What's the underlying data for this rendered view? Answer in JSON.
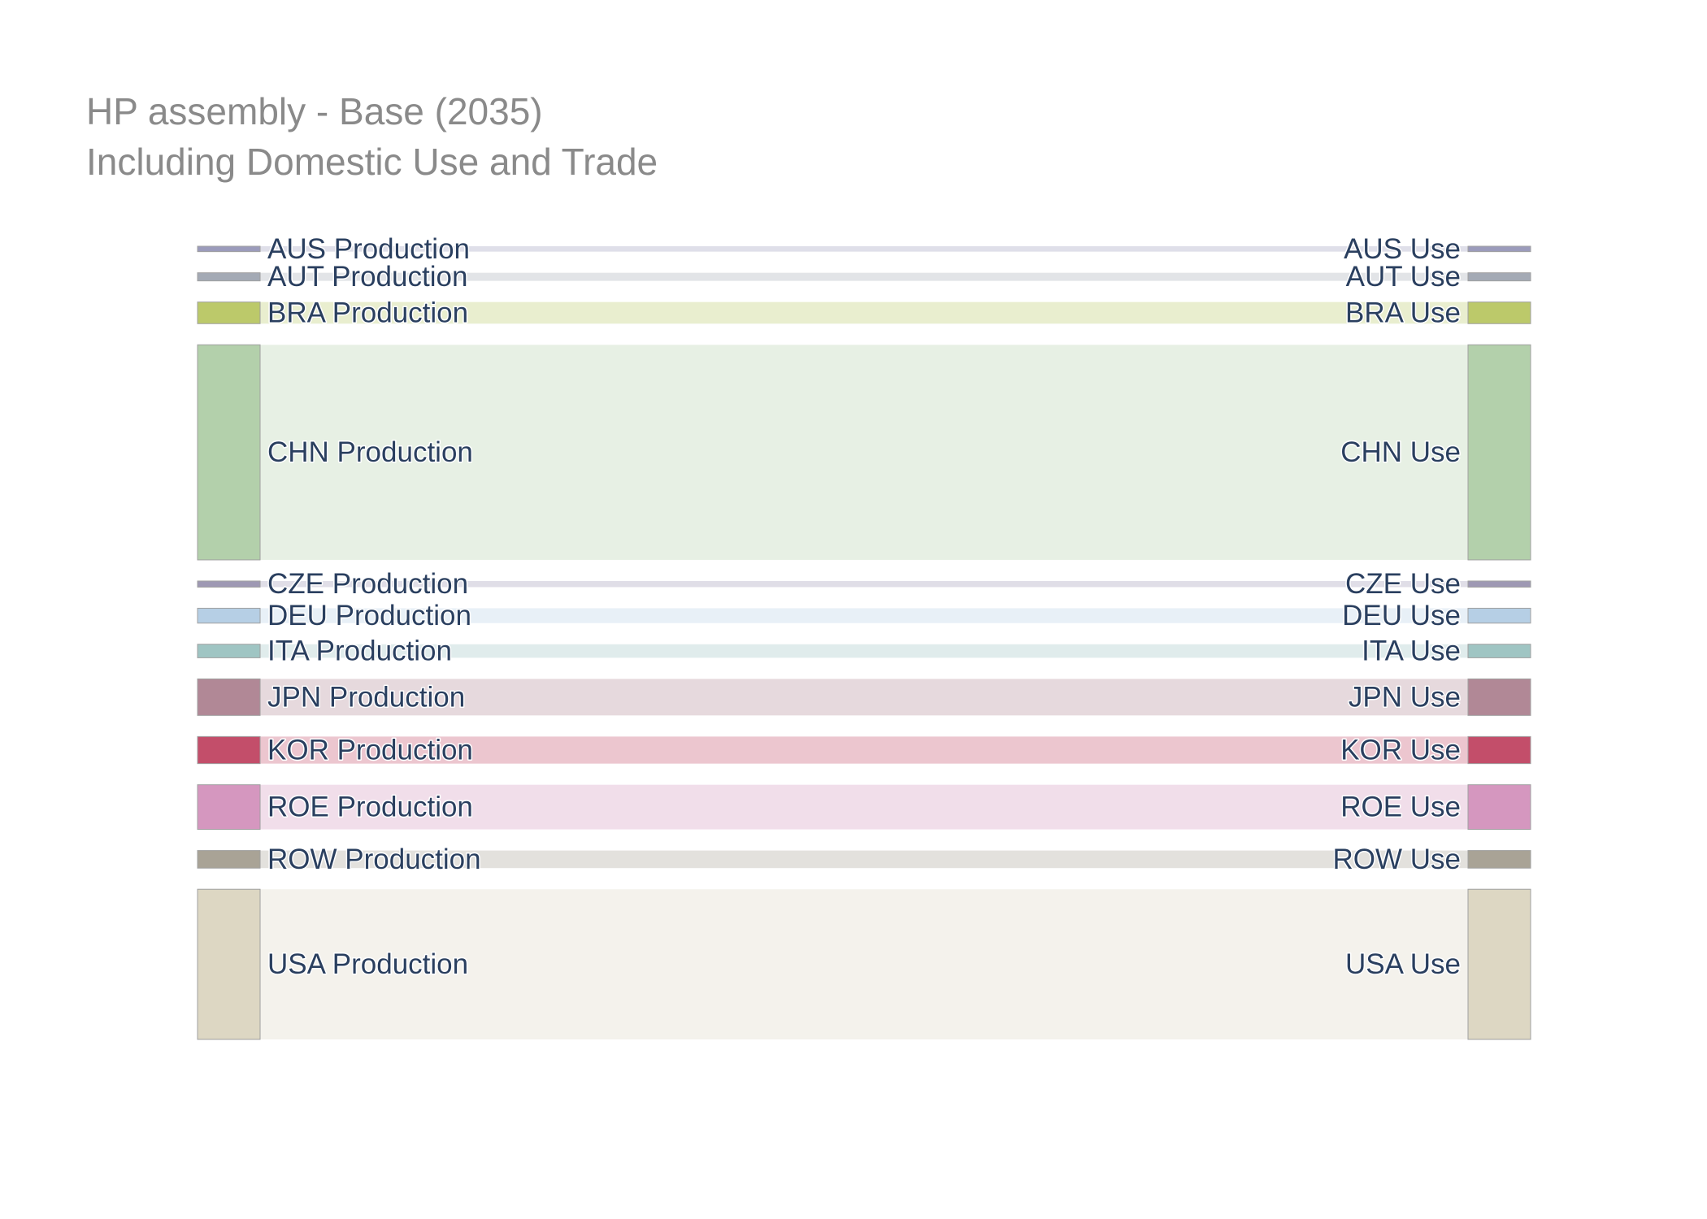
{
  "title": {
    "line1": "HP assembly - Base (2035)",
    "line2": "Including Domestic Use and Trade"
  },
  "chart_data": {
    "type": "sankey",
    "title": "HP assembly - Base (2035)",
    "subtitle": "Including Domestic Use and Trade",
    "flows": [
      {
        "source": "AUS Production",
        "target": "AUS Use",
        "value": 0.4,
        "color": "#9b9bbb"
      },
      {
        "source": "AUT Production",
        "target": "AUT Use",
        "value": 0.6,
        "color": "#a4aab5"
      },
      {
        "source": "BRA Production",
        "target": "BRA Use",
        "value": 1.6,
        "color": "#bcc96a"
      },
      {
        "source": "CHN Production",
        "target": "CHN Use",
        "value": 15.9,
        "color": "#b3d0ab"
      },
      {
        "source": "CZE Production",
        "target": "CZE Use",
        "value": 0.45,
        "color": "#9e98b3"
      },
      {
        "source": "DEU Production",
        "target": "DEU Use",
        "value": 1.1,
        "color": "#b6cfe5"
      },
      {
        "source": "ITA Production",
        "target": "ITA Use",
        "value": 1.0,
        "color": "#9fc5c3"
      },
      {
        "source": "JPN Production",
        "target": "JPN Use",
        "value": 2.7,
        "color": "#b18896"
      },
      {
        "source": "KOR Production",
        "target": "KOR Use",
        "value": 2.0,
        "color": "#c34e6a"
      },
      {
        "source": "ROE Production",
        "target": "ROE Use",
        "value": 3.3,
        "color": "#d597bf"
      },
      {
        "source": "ROW Production",
        "target": "ROW Use",
        "value": 1.3,
        "color": "#a9a396"
      },
      {
        "source": "USA Production",
        "target": "USA Use",
        "value": 11.1,
        "color": "#ddd7c3"
      }
    ]
  }
}
